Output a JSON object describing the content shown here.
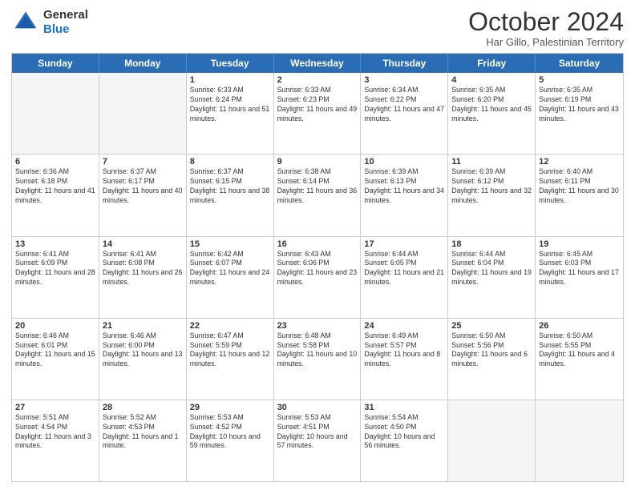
{
  "logo": {
    "general": "General",
    "blue": "Blue"
  },
  "title": "October 2024",
  "location": "Har Gillo, Palestinian Territory",
  "days_of_week": [
    "Sunday",
    "Monday",
    "Tuesday",
    "Wednesday",
    "Thursday",
    "Friday",
    "Saturday"
  ],
  "weeks": [
    [
      {
        "day": "",
        "info": "",
        "empty": true
      },
      {
        "day": "",
        "info": "",
        "empty": true
      },
      {
        "day": "1",
        "sunrise": "Sunrise: 6:33 AM",
        "sunset": "Sunset: 6:24 PM",
        "daylight": "Daylight: 11 hours and 51 minutes."
      },
      {
        "day": "2",
        "sunrise": "Sunrise: 6:33 AM",
        "sunset": "Sunset: 6:23 PM",
        "daylight": "Daylight: 11 hours and 49 minutes."
      },
      {
        "day": "3",
        "sunrise": "Sunrise: 6:34 AM",
        "sunset": "Sunset: 6:22 PM",
        "daylight": "Daylight: 11 hours and 47 minutes."
      },
      {
        "day": "4",
        "sunrise": "Sunrise: 6:35 AM",
        "sunset": "Sunset: 6:20 PM",
        "daylight": "Daylight: 11 hours and 45 minutes."
      },
      {
        "day": "5",
        "sunrise": "Sunrise: 6:35 AM",
        "sunset": "Sunset: 6:19 PM",
        "daylight": "Daylight: 11 hours and 43 minutes."
      }
    ],
    [
      {
        "day": "6",
        "sunrise": "Sunrise: 6:36 AM",
        "sunset": "Sunset: 6:18 PM",
        "daylight": "Daylight: 11 hours and 41 minutes."
      },
      {
        "day": "7",
        "sunrise": "Sunrise: 6:37 AM",
        "sunset": "Sunset: 6:17 PM",
        "daylight": "Daylight: 11 hours and 40 minutes."
      },
      {
        "day": "8",
        "sunrise": "Sunrise: 6:37 AM",
        "sunset": "Sunset: 6:15 PM",
        "daylight": "Daylight: 11 hours and 38 minutes."
      },
      {
        "day": "9",
        "sunrise": "Sunrise: 6:38 AM",
        "sunset": "Sunset: 6:14 PM",
        "daylight": "Daylight: 11 hours and 36 minutes."
      },
      {
        "day": "10",
        "sunrise": "Sunrise: 6:39 AM",
        "sunset": "Sunset: 6:13 PM",
        "daylight": "Daylight: 11 hours and 34 minutes."
      },
      {
        "day": "11",
        "sunrise": "Sunrise: 6:39 AM",
        "sunset": "Sunset: 6:12 PM",
        "daylight": "Daylight: 11 hours and 32 minutes."
      },
      {
        "day": "12",
        "sunrise": "Sunrise: 6:40 AM",
        "sunset": "Sunset: 6:11 PM",
        "daylight": "Daylight: 11 hours and 30 minutes."
      }
    ],
    [
      {
        "day": "13",
        "sunrise": "Sunrise: 6:41 AM",
        "sunset": "Sunset: 6:09 PM",
        "daylight": "Daylight: 11 hours and 28 minutes."
      },
      {
        "day": "14",
        "sunrise": "Sunrise: 6:41 AM",
        "sunset": "Sunset: 6:08 PM",
        "daylight": "Daylight: 11 hours and 26 minutes."
      },
      {
        "day": "15",
        "sunrise": "Sunrise: 6:42 AM",
        "sunset": "Sunset: 6:07 PM",
        "daylight": "Daylight: 11 hours and 24 minutes."
      },
      {
        "day": "16",
        "sunrise": "Sunrise: 6:43 AM",
        "sunset": "Sunset: 6:06 PM",
        "daylight": "Daylight: 11 hours and 23 minutes."
      },
      {
        "day": "17",
        "sunrise": "Sunrise: 6:44 AM",
        "sunset": "Sunset: 6:05 PM",
        "daylight": "Daylight: 11 hours and 21 minutes."
      },
      {
        "day": "18",
        "sunrise": "Sunrise: 6:44 AM",
        "sunset": "Sunset: 6:04 PM",
        "daylight": "Daylight: 11 hours and 19 minutes."
      },
      {
        "day": "19",
        "sunrise": "Sunrise: 6:45 AM",
        "sunset": "Sunset: 6:03 PM",
        "daylight": "Daylight: 11 hours and 17 minutes."
      }
    ],
    [
      {
        "day": "20",
        "sunrise": "Sunrise: 6:46 AM",
        "sunset": "Sunset: 6:01 PM",
        "daylight": "Daylight: 11 hours and 15 minutes."
      },
      {
        "day": "21",
        "sunrise": "Sunrise: 6:46 AM",
        "sunset": "Sunset: 6:00 PM",
        "daylight": "Daylight: 11 hours and 13 minutes."
      },
      {
        "day": "22",
        "sunrise": "Sunrise: 6:47 AM",
        "sunset": "Sunset: 5:59 PM",
        "daylight": "Daylight: 11 hours and 12 minutes."
      },
      {
        "day": "23",
        "sunrise": "Sunrise: 6:48 AM",
        "sunset": "Sunset: 5:58 PM",
        "daylight": "Daylight: 11 hours and 10 minutes."
      },
      {
        "day": "24",
        "sunrise": "Sunrise: 6:49 AM",
        "sunset": "Sunset: 5:57 PM",
        "daylight": "Daylight: 11 hours and 8 minutes."
      },
      {
        "day": "25",
        "sunrise": "Sunrise: 6:50 AM",
        "sunset": "Sunset: 5:56 PM",
        "daylight": "Daylight: 11 hours and 6 minutes."
      },
      {
        "day": "26",
        "sunrise": "Sunrise: 6:50 AM",
        "sunset": "Sunset: 5:55 PM",
        "daylight": "Daylight: 11 hours and 4 minutes."
      }
    ],
    [
      {
        "day": "27",
        "sunrise": "Sunrise: 5:51 AM",
        "sunset": "Sunset: 4:54 PM",
        "daylight": "Daylight: 11 hours and 3 minutes."
      },
      {
        "day": "28",
        "sunrise": "Sunrise: 5:52 AM",
        "sunset": "Sunset: 4:53 PM",
        "daylight": "Daylight: 11 hours and 1 minute."
      },
      {
        "day": "29",
        "sunrise": "Sunrise: 5:53 AM",
        "sunset": "Sunset: 4:52 PM",
        "daylight": "Daylight: 10 hours and 59 minutes."
      },
      {
        "day": "30",
        "sunrise": "Sunrise: 5:53 AM",
        "sunset": "Sunset: 4:51 PM",
        "daylight": "Daylight: 10 hours and 57 minutes."
      },
      {
        "day": "31",
        "sunrise": "Sunrise: 5:54 AM",
        "sunset": "Sunset: 4:50 PM",
        "daylight": "Daylight: 10 hours and 56 minutes."
      },
      {
        "day": "",
        "info": "",
        "empty": true
      },
      {
        "day": "",
        "info": "",
        "empty": true
      }
    ]
  ]
}
